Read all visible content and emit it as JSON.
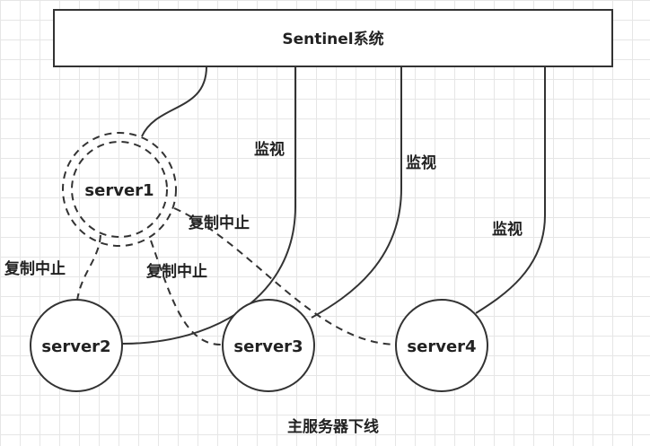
{
  "system_label": "Sentinel系统",
  "nodes": {
    "server1": "server1",
    "server2": "server2",
    "server3": "server3",
    "server4": "server4"
  },
  "edge_labels": {
    "monitor_1": "监视",
    "monitor_2": "监视",
    "monitor_3": "监视",
    "repl_stop_1": "复制中止",
    "repl_stop_2": "复制中止",
    "repl_stop_3": "复制中止"
  },
  "caption": "主服务器下线",
  "colors": {
    "stroke": "#333333",
    "text": "#222222",
    "grid": "#e6e6e6"
  }
}
